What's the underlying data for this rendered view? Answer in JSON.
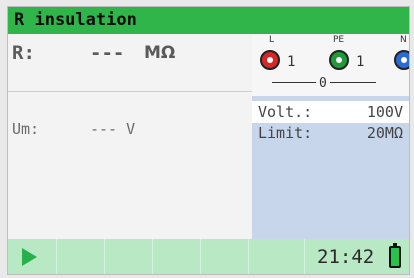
{
  "header": {
    "title": "R insulation"
  },
  "result": {
    "r_label": "R:",
    "r_value": "---",
    "r_unit": "MΩ"
  },
  "um": {
    "label": "Um:",
    "value": "--- V"
  },
  "terminals": {
    "l": {
      "letter": "L",
      "color": "#d62828",
      "num": "1"
    },
    "pe": {
      "letter": "PE",
      "color": "#1e9a3a",
      "num": "1"
    },
    "n": {
      "letter": "N",
      "color": "#2a6bd6"
    },
    "common": "0"
  },
  "params": [
    {
      "label": "Volt.:",
      "value": "100V"
    },
    {
      "label": "Limit:",
      "value": "20MΩ"
    }
  ],
  "footer": {
    "time": "21:42",
    "battery": "battery-full-icon"
  },
  "colors": {
    "title_bar": "#2fb54a",
    "footer": "#b8e8c4",
    "side_panel": "#c8d6ec"
  }
}
